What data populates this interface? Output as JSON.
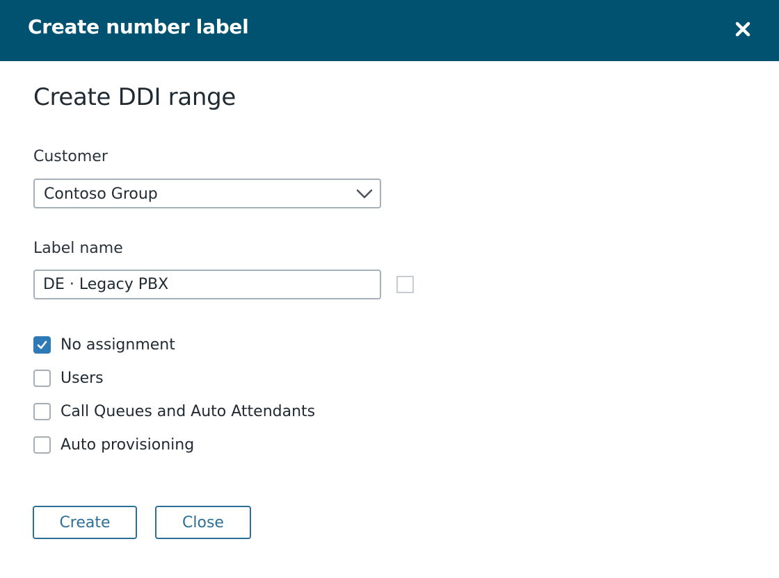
{
  "dialog": {
    "title": "Create number label",
    "close_icon": "close-icon"
  },
  "form": {
    "heading": "Create DDI range",
    "customer": {
      "label": "Customer",
      "selected": "Contoso Group"
    },
    "label_name": {
      "label": "Label name",
      "value": "DE · Legacy PBX",
      "side_checkbox_checked": false
    },
    "options": [
      {
        "label": "No assignment",
        "checked": true
      },
      {
        "label": "Users",
        "checked": false
      },
      {
        "label": "Call Queues and Auto Attendants",
        "checked": false
      },
      {
        "label": "Auto provisioning",
        "checked": false
      }
    ]
  },
  "buttons": {
    "create_label": "Create",
    "close_label": "Close"
  },
  "colors": {
    "header_bg": "#005270",
    "accent": "#2d7ab6",
    "button_text": "#2d6f96"
  }
}
